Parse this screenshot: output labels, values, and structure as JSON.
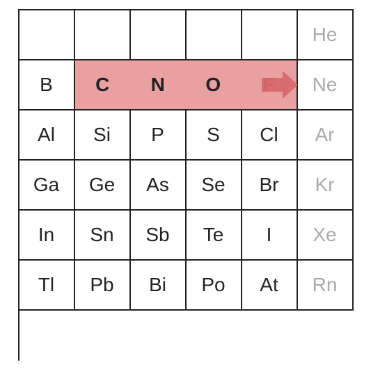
{
  "table": {
    "rows": [
      [
        null,
        null,
        null,
        null,
        null,
        "He"
      ],
      [
        "B",
        "C",
        "N",
        "O",
        "F",
        "Ne"
      ],
      [
        "Al",
        "Si",
        "P",
        "S",
        "Cl",
        "Ar"
      ],
      [
        "Ga",
        "Ge",
        "As",
        "Se",
        "Br",
        "Kr"
      ],
      [
        "In",
        "Sn",
        "Sb",
        "Te",
        "I",
        "Xe"
      ],
      [
        "Tl",
        "Pb",
        "Bi",
        "Po",
        "At",
        "Rn"
      ]
    ],
    "noble_gas_indices": [
      5
    ],
    "highlighted_row": 1,
    "highlighted_cols": [
      1,
      2,
      3,
      4
    ],
    "arrow_elements": [
      "C",
      "N",
      "O",
      "F"
    ]
  }
}
